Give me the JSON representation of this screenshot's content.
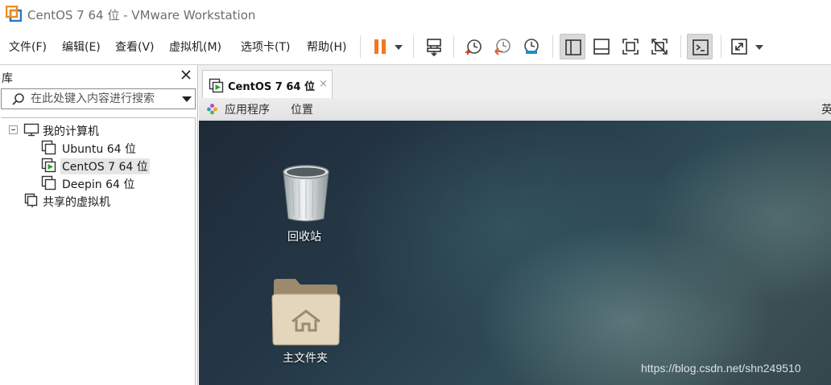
{
  "window": {
    "title": "CentOS 7 64 位 - VMware Workstation"
  },
  "menu": {
    "items": [
      {
        "label": "文件(F)"
      },
      {
        "label": "编辑(E)"
      },
      {
        "label": "查看(V)"
      },
      {
        "label": "虚拟机(M)"
      },
      {
        "label": "选项卡(T)"
      },
      {
        "label": "帮助(H)"
      }
    ]
  },
  "toolbar": {
    "icons": [
      "pause-icon",
      "send-ctrl-alt-del-icon",
      "snapshot-take-icon",
      "snapshot-revert-icon",
      "snapshot-manager-icon",
      "show-library-icon",
      "show-thumbnail-bar-icon",
      "full-screen-icon",
      "unity-icon",
      "console-view-icon",
      "stretch-guest-icon"
    ],
    "active": [
      "show-library-icon",
      "console-view-icon"
    ],
    "accent_color": "#f07820"
  },
  "library": {
    "title": "库",
    "search_placeholder": "在此处键入内容进行搜索",
    "tree": {
      "root": {
        "label": "我的计算机",
        "expanded": true
      },
      "vms": [
        {
          "label": "Ubuntu 64 位",
          "running": false
        },
        {
          "label": "CentOS 7 64 位",
          "running": true,
          "selected": true
        },
        {
          "label": "Deepin 64 位",
          "running": false
        }
      ],
      "shared": {
        "label": "共享的虚拟机"
      }
    }
  },
  "tabs": [
    {
      "label": "CentOS 7 64 位",
      "close": "×",
      "active": true
    }
  ],
  "guest": {
    "topbar": {
      "applications": "应用程序",
      "places": "位置",
      "input_method": "英"
    },
    "desktop_icons": [
      {
        "label": "回收站",
        "icon": "trash-icon"
      },
      {
        "label": "主文件夹",
        "icon": "home-folder-icon"
      }
    ]
  },
  "watermark": "https://blog.csdn.net/shn249510"
}
